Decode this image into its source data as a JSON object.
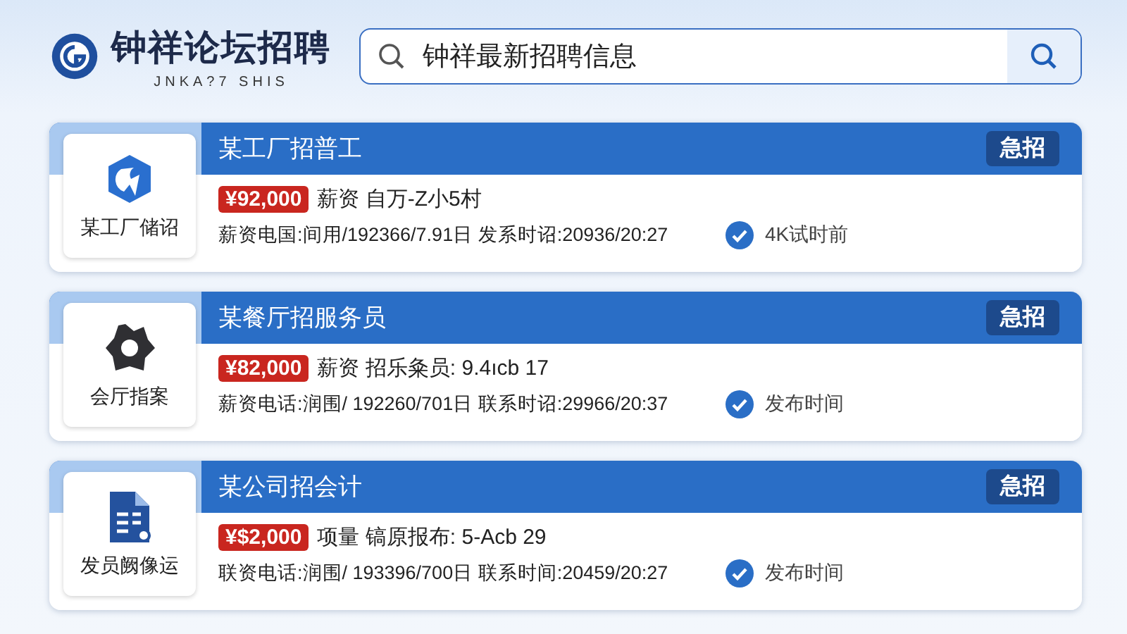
{
  "header": {
    "title": "钟祥论坛招聘",
    "subtitle": "JNKA?7 SHIS",
    "search": {
      "value": "钟祥最新招聘信息"
    }
  },
  "jobs": [
    {
      "title": "某工厂招普工",
      "badge": "急招",
      "kind": "swirl",
      "logo_label": "某工厂储诏",
      "salary": "¥92,000",
      "salary_note": "薪资 自万-Z小5村",
      "info": "薪资电国:间用/192366/7.91日 发系时诏:20936/20:27",
      "status": "4K试时前"
    },
    {
      "title": "某餐厅招服务员",
      "badge": "急招",
      "kind": "gear",
      "logo_label": "会厅指案",
      "salary": "¥82,000",
      "salary_note": "薪资 招乐粂员: 9.4ıcb 17",
      "info": "薪资电话:润围/ 192260/701日 联系时诏:29966/20:37",
      "status": "发布时间"
    },
    {
      "title": "某公司招会计",
      "badge": "急招",
      "kind": "document",
      "logo_label": "发员阙像运",
      "salary": "¥$2,000",
      "salary_note": "项量 镐原报布: 5-Acb 29",
      "info": "联资电话:润围/ 193396/700日 联系时间:20459/20:27",
      "status": "发布时间"
    }
  ]
}
